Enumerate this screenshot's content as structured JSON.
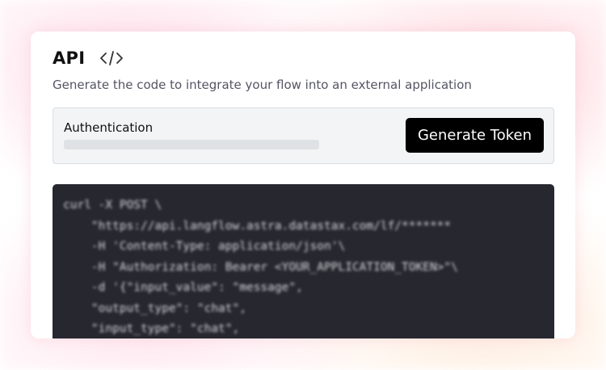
{
  "header": {
    "title": "API",
    "icon": "code-icon"
  },
  "subtitle": "Generate the code to integrate your flow into an external application",
  "auth": {
    "label": "Authentication",
    "generate_button": "Generate Token"
  },
  "code": {
    "lines": [
      "curl -X POST \\",
      "    \"https://api.langflow.astra.datastax.com/lf/*******",
      "    -H 'Content-Type: application/json'\\",
      "    -H \"Authorization: Bearer <YOUR_APPLICATION_TOKEN>\"\\",
      "    -d '{\"input_value\": \"message\",",
      "    \"output_type\": \"chat\",",
      "    \"input_type\": \"chat\","
    ]
  },
  "colors": {
    "button_bg": "#000000",
    "code_bg": "#27272f",
    "panel_bg": "#f2f4f5"
  }
}
